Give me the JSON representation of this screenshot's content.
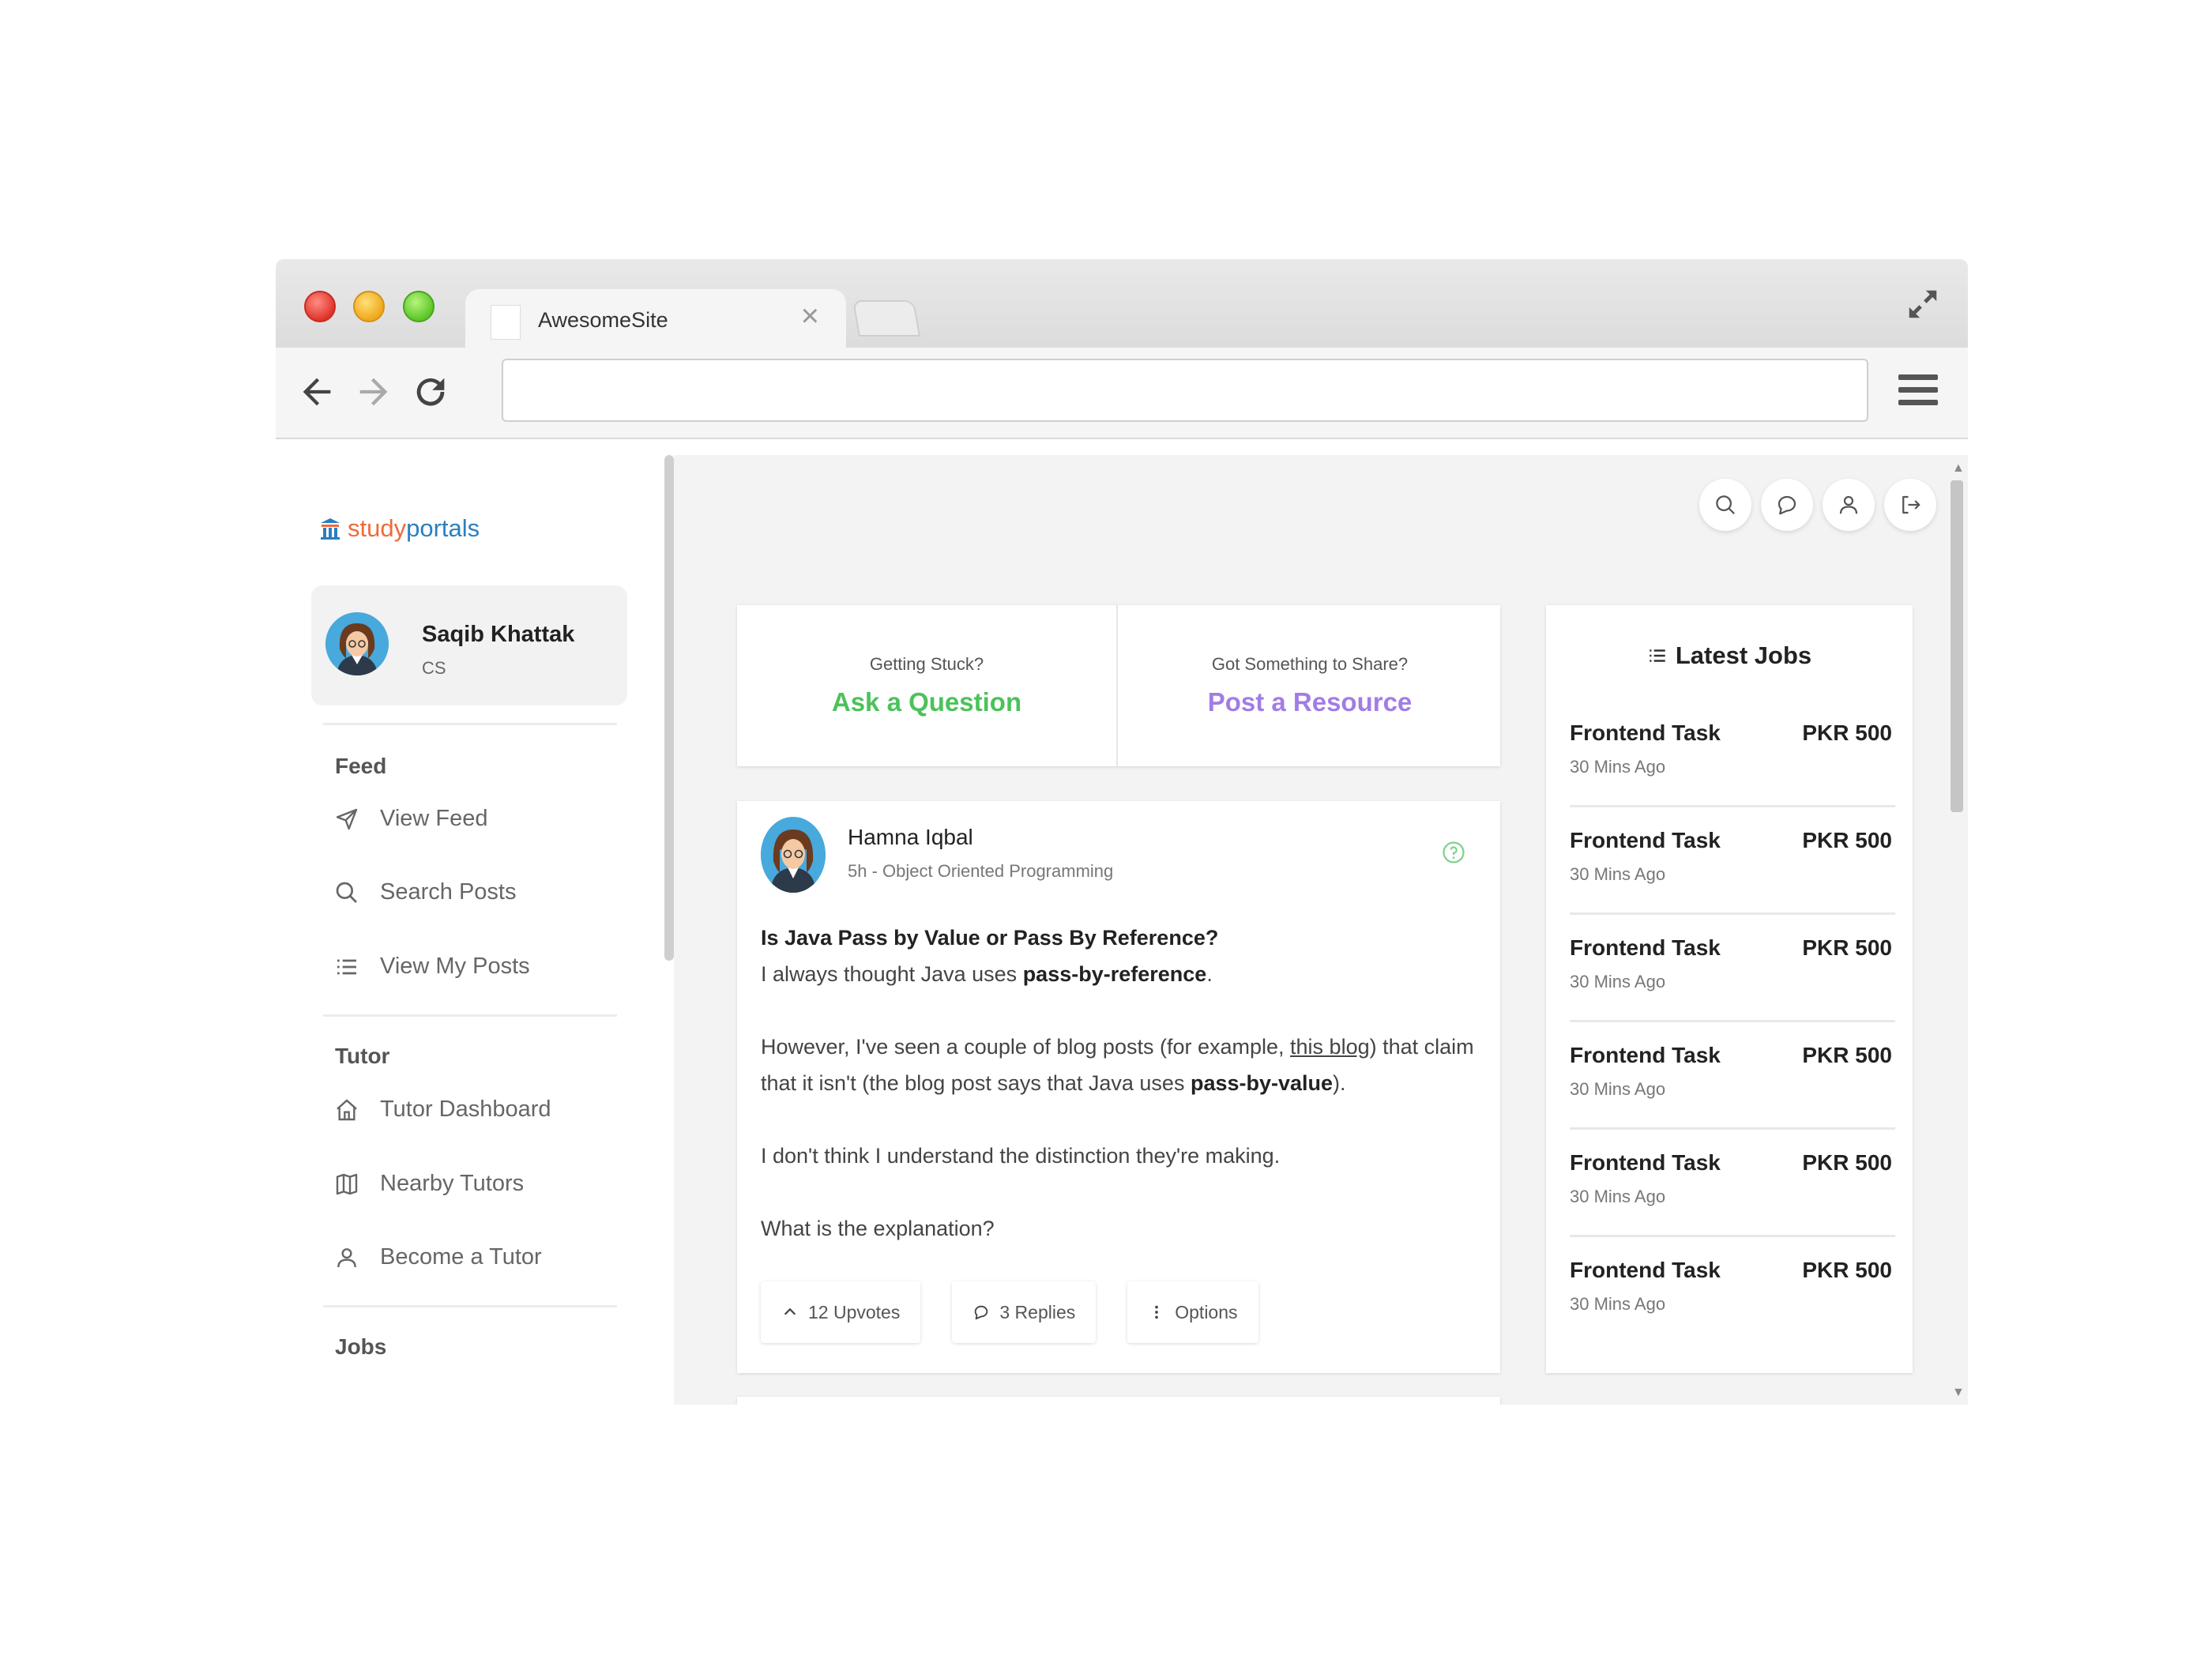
{
  "browser": {
    "tab_title": "AwesomeSite",
    "url": ""
  },
  "sidebar": {
    "logo_study": "study",
    "logo_portals": "portals",
    "user": {
      "name": "Saqib Khattak",
      "dept": "CS"
    },
    "sections": [
      {
        "title": "Feed",
        "items": [
          {
            "label": "View Feed",
            "icon": "send-icon"
          },
          {
            "label": "Search Posts",
            "icon": "search-icon"
          },
          {
            "label": "View My Posts",
            "icon": "list-icon"
          }
        ]
      },
      {
        "title": "Tutor",
        "items": [
          {
            "label": "Tutor Dashboard",
            "icon": "home-icon"
          },
          {
            "label": "Nearby Tutors",
            "icon": "map-icon"
          },
          {
            "label": "Become a Tutor",
            "icon": "user-icon"
          }
        ]
      },
      {
        "title": "Jobs",
        "items": []
      }
    ]
  },
  "topbar": {
    "icons": [
      "search-icon",
      "chat-icon",
      "user-icon",
      "logout-icon"
    ]
  },
  "ask": {
    "question_sub": "Getting Stuck?",
    "question_cta": "Ask a Question",
    "resource_sub": "Got Something to Share?",
    "resource_cta": "Post a Resource",
    "green": "#4bc25a",
    "purple": "#a27ce6"
  },
  "post": {
    "author": "Hamna Iqbal",
    "meta": "5h - Object Oriented Programming",
    "title": "Is Java Pass by Value or Pass By Reference?",
    "line1_pre": "I always thought Java uses ",
    "line1_bold": "pass-by-reference",
    "line1_post": ".",
    "line2_pre": "However, I've seen a couple of blog posts (for example, ",
    "line2_link": "this blog",
    "line2_mid": ") that claim that it isn't (the blog post says that Java uses ",
    "line2_bold": "pass-by-value",
    "line2_post": ").",
    "line3": "I don't think I understand the distinction they're making.",
    "line4": "What is the explanation?",
    "upvotes": "12 Upvotes",
    "replies": "3 Replies",
    "options": "Options"
  },
  "jobs": {
    "header": "Latest Jobs",
    "items": [
      {
        "title": "Frontend Task",
        "time": "30 Mins Ago",
        "price": "PKR 500"
      },
      {
        "title": "Frontend Task",
        "time": "30 Mins Ago",
        "price": "PKR 500"
      },
      {
        "title": "Frontend Task",
        "time": "30 Mins Ago",
        "price": "PKR 500"
      },
      {
        "title": "Frontend Task",
        "time": "30 Mins Ago",
        "price": "PKR 500"
      },
      {
        "title": "Frontend Task",
        "time": "30 Mins Ago",
        "price": "PKR 500"
      },
      {
        "title": "Frontend Task",
        "time": "30 Mins Ago",
        "price": "PKR 500"
      }
    ]
  }
}
